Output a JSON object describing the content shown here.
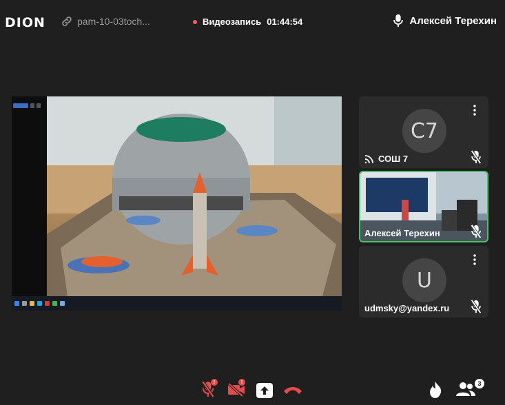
{
  "header": {
    "logo": "DION",
    "link_text": "pam-10-03toch...",
    "recording_label": "Видеозапись",
    "recording_time": "01:44:54",
    "current_user": "Алексей Терехин"
  },
  "screen_share": {
    "taskbar_icons": [
      "windows-logo",
      "search",
      "explorer",
      "edge",
      "acrobat",
      "chrome",
      "presenter"
    ]
  },
  "participants": [
    {
      "initials": "С7",
      "name": "СОШ 7",
      "muted": true,
      "status_icon": "signal-icon"
    },
    {
      "name": "Алексей Терехин",
      "muted": true,
      "active_speaker": true,
      "has_video": true
    },
    {
      "initials": "U",
      "name": "udmsky@yandex.ru",
      "muted": true
    }
  ],
  "controls": {
    "participant_count": "3",
    "mic_badge": "!",
    "camera_badge": "!"
  },
  "colors": {
    "background": "#1f1f1f",
    "tile": "#2b2b2b",
    "active_border": "#4dc16a",
    "danger": "#e24c4c",
    "recording_dot": "#ff5a5a"
  }
}
